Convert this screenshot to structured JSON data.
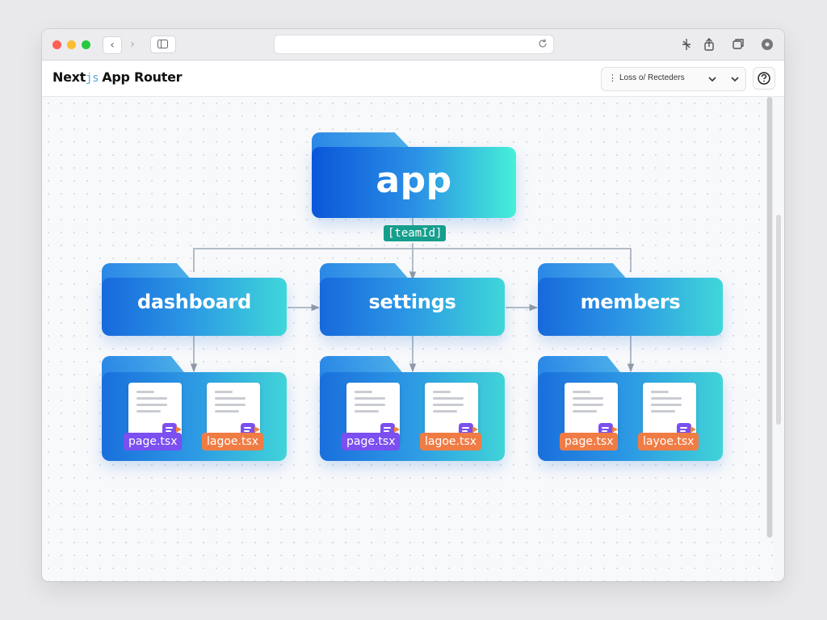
{
  "header": {
    "brand_main": "Next",
    "brand_js": "js",
    "brand_title": "App Router",
    "dropdown_label": "Loss o/ Recteders"
  },
  "diagram": {
    "root": "app",
    "param": "[teamId]",
    "children": [
      {
        "name": "dashboard",
        "files": [
          {
            "label": "page.tsx",
            "color": "#7b4ff0"
          },
          {
            "label": "lagoe.tsx",
            "color": "#f07c45"
          }
        ]
      },
      {
        "name": "settings",
        "files": [
          {
            "label": "page.tsx",
            "color": "#7b4ff0"
          },
          {
            "label": "lagoe.tsx",
            "color": "#f07c45"
          }
        ]
      },
      {
        "name": "members",
        "files": [
          {
            "label": "page.tsx",
            "color": "#f07c45"
          },
          {
            "label": "layoe.tsx",
            "color": "#f07c45"
          }
        ]
      }
    ]
  },
  "icons": {
    "back": "chevron-left-icon",
    "forward": "chevron-right-icon",
    "sidebar": "sidebar-icon",
    "reload": "reload-icon",
    "extension": "extension-icon",
    "share": "share-icon",
    "tabs": "tabs-icon",
    "settings": "gear-icon",
    "help": "help-icon"
  }
}
